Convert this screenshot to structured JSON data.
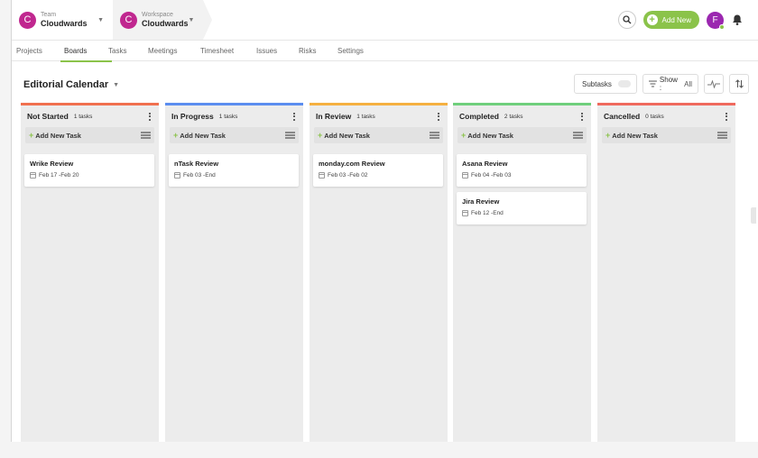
{
  "topbar": {
    "team": {
      "avatar": "C",
      "label": "Team",
      "name": "Cloudwards"
    },
    "workspace": {
      "avatar": "C",
      "label": "Workspace",
      "name": "Cloudwards"
    },
    "add_new_label": "Add New",
    "user_avatar": "F"
  },
  "nav": {
    "tabs": [
      "Projects",
      "Boards",
      "Tasks",
      "Meetings",
      "Timesheet",
      "Issues",
      "Risks",
      "Settings"
    ],
    "active": "Boards"
  },
  "header": {
    "board_title": "Editorial Calendar",
    "subtasks_label": "Subtasks",
    "show_label": "Show :",
    "show_value": "All"
  },
  "columns": [
    {
      "title": "Not Started",
      "count": "1 tasks",
      "color": "#f0704f",
      "add_label": "Add New Task",
      "cards": [
        {
          "title": "Wrike Review",
          "date": "Feb 17 -Feb 20"
        }
      ]
    },
    {
      "title": "In Progress",
      "count": "1 tasks",
      "color": "#5b8def",
      "add_label": "Add New Task",
      "cards": [
        {
          "title": "nTask Review",
          "date": "Feb 03 -End"
        }
      ]
    },
    {
      "title": "In Review",
      "count": "1 tasks",
      "color": "#f5b041",
      "add_label": "Add New Task",
      "cards": [
        {
          "title": "monday.com Review",
          "date": "Feb 03 -Feb 02"
        }
      ]
    },
    {
      "title": "Completed",
      "count": "2 tasks",
      "color": "#6fcf7c",
      "add_label": "Add New Task",
      "cards": [
        {
          "title": "Asana Review",
          "date": "Feb 04 -Feb 03"
        },
        {
          "title": "Jira Review",
          "date": "Feb 12 -End"
        }
      ]
    },
    {
      "title": "Cancelled",
      "count": "0 tasks",
      "color": "#ef6a5e",
      "add_label": "Add New Task",
      "cards": []
    }
  ]
}
